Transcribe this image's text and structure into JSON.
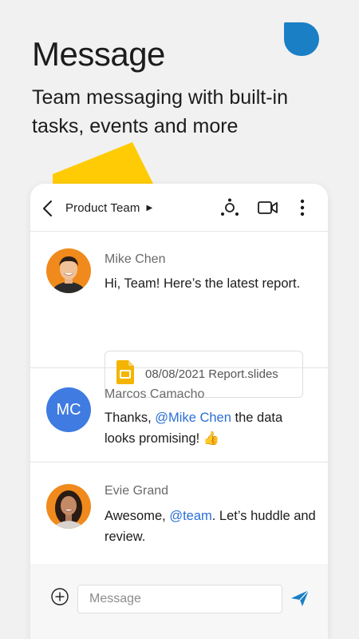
{
  "promo": {
    "headline": "Message",
    "subhead": "Team messaging with built-in tasks, events and more"
  },
  "colors": {
    "accent_blue": "#1a7fc4",
    "accent_yellow": "#ffcb05",
    "mention_blue": "#2a6fd6",
    "avatar_mc": "#3f7be0"
  },
  "chat": {
    "title": "Product Team",
    "icons": [
      "back-icon",
      "caret-right-icon",
      "participants-icon",
      "video-call-icon",
      "more-vert-icon"
    ]
  },
  "messages": [
    {
      "sender": "Mike Chen",
      "text": "Hi, Team! Here’s the latest report.",
      "attachment": "08/08/2021 Report.slides"
    },
    {
      "sender": "Marcos Camacho",
      "initials": "MC",
      "text_before": "Thanks, ",
      "mention": "@Mike Chen",
      "text_after": " the data looks promising! 👍"
    },
    {
      "sender": "Evie Grand",
      "text_before": "Awesome, ",
      "mention": "@team",
      "text_after": ". Let’s huddle and review."
    }
  ],
  "composer": {
    "placeholder": "Message"
  }
}
